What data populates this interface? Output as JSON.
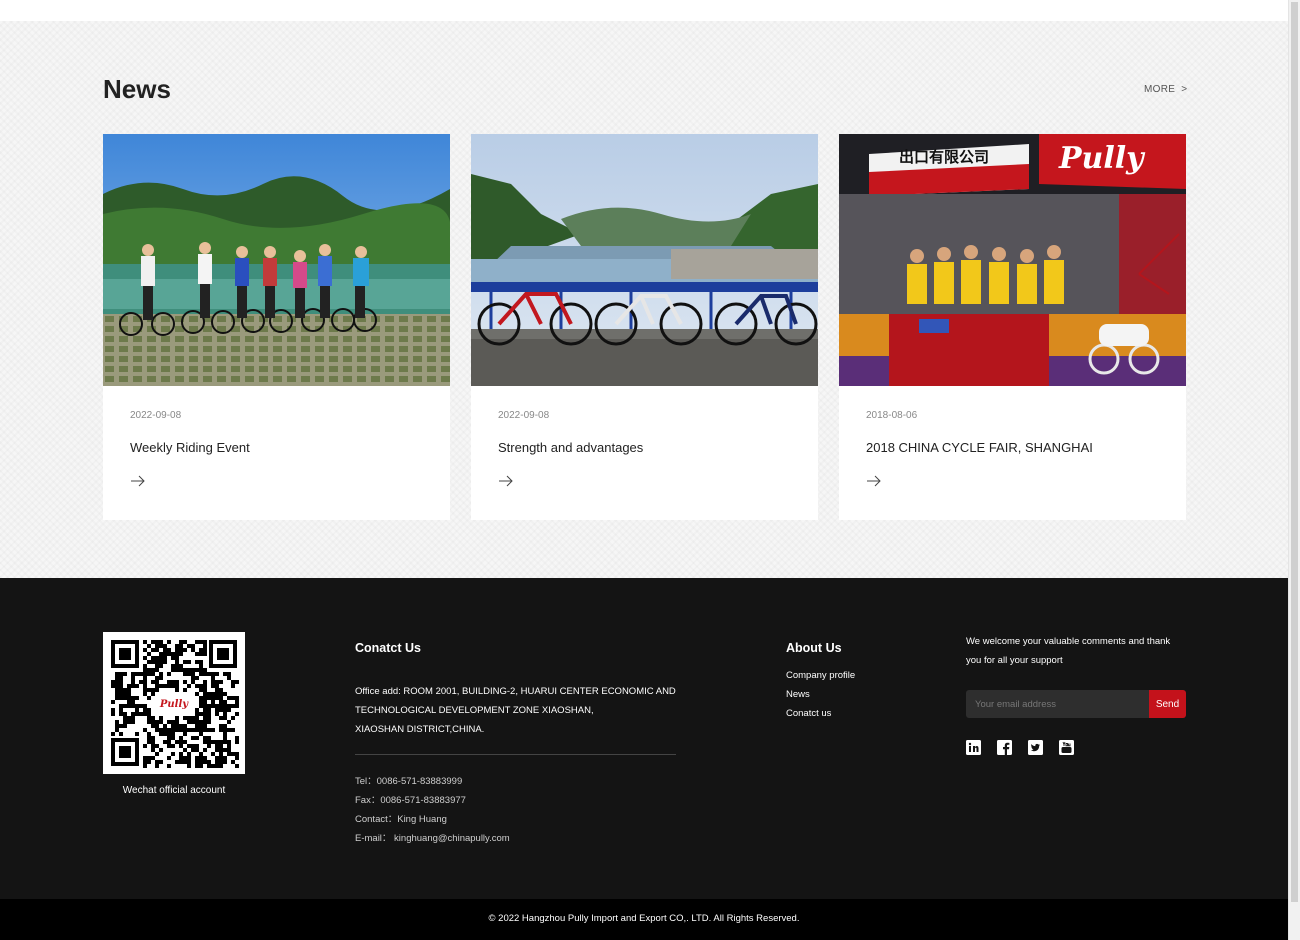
{
  "news": {
    "title": "News",
    "more_label": "MORE",
    "more_chevron": ">",
    "items": [
      {
        "date": "2022-09-08",
        "title": "Weekly Riding Event",
        "image_subject": "cyclists-by-lake"
      },
      {
        "date": "2022-09-08",
        "title": "Strength and advantages",
        "image_subject": "bikes-on-river-bridge"
      },
      {
        "date": "2018-08-06",
        "title": "2018 CHINA CYCLE FAIR, SHANGHAI",
        "image_subject": "trade-fair-booth"
      }
    ]
  },
  "footer": {
    "qr_caption": "Wechat official account",
    "qr_logo_text": "Pully",
    "contact": {
      "heading": "Conatct Us",
      "address_line1": "Office add: ROOM 2001, BUILDING-2, HUARUI CENTER ECONOMIC AND",
      "address_line2": "TECHNOLOGICAL DEVELOPMENT ZONE XIAOSHAN,",
      "address_line3": "XIAOSHAN DISTRICT,CHINA.",
      "tel": "Tel：0086-571-83883999",
      "fax": "Fax：0086-571-83883977",
      "contact_person": "Contact：King Huang",
      "email": "E-mail： kinghuang@chinapully.com"
    },
    "about": {
      "heading": "About Us",
      "links": [
        "Company profile",
        "News",
        "Conatct us"
      ]
    },
    "subscribe": {
      "welcome_text": "We welcome your valuable comments and thank you for all your support",
      "email_placeholder": "Your email address",
      "send_label": "Send"
    },
    "social_icons": [
      "linkedin-icon",
      "facebook-icon",
      "twitter-icon",
      "youtube-icon"
    ],
    "copyright": "© 2022 Hangzhou Pully Import and Export CO,. LTD. All Rights Reserved."
  },
  "colors": {
    "accent_red": "#c4121b",
    "footer_bg": "#141414",
    "copyright_bg": "#000000",
    "section_bg": "#f6f6f6"
  }
}
